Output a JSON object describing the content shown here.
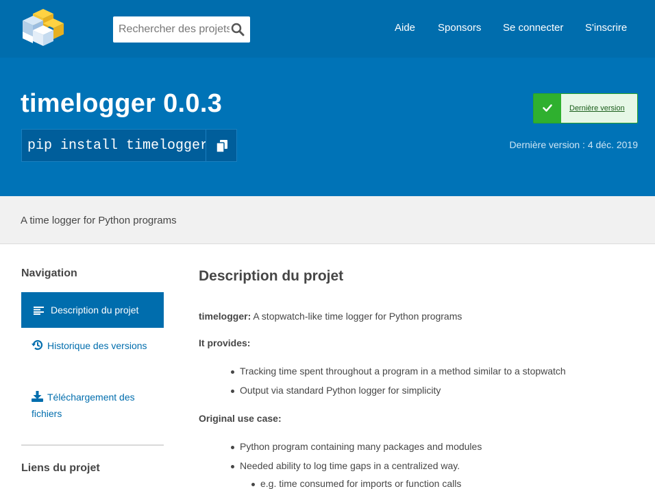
{
  "header": {
    "search_placeholder": "Rechercher des projets",
    "nav": [
      "Aide",
      "Sponsors",
      "Se connecter",
      "S'inscrire"
    ]
  },
  "banner": {
    "package_title": "timelogger 0.0.3",
    "pip_command": "pip install timelogger",
    "latest_badge": "Dernière version",
    "release_date": "Dernière version : 4 déc. 2019"
  },
  "summary": "A time logger for Python programs",
  "sidebar": {
    "navigation_heading": "Navigation",
    "items": [
      {
        "label": "Description du projet",
        "icon": "align-left-icon",
        "active": true
      },
      {
        "label": "Historique des versions",
        "icon": "history-icon",
        "active": false
      },
      {
        "label": "Téléchargement des fichiers",
        "icon": "download-icon",
        "active": false
      }
    ],
    "links_heading": "Liens du projet"
  },
  "main": {
    "title": "Description du projet",
    "intro_bold": "timelogger:",
    "intro_rest": " A stopwatch-like time logger for Python programs",
    "provides_heading": "It provides:",
    "provides": [
      "Tracking time spent throughout a program in a method similar to a stopwatch",
      "Output via standard Python logger for simplicity"
    ],
    "use_case_heading": "Original use case:",
    "use_cases": [
      "Python program containing many packages and modules",
      "Needed ability to log time gaps in a centralized way."
    ],
    "sub_use_case": "e.g. time consumed for imports or function calls"
  },
  "colors": {
    "header_blue": "#006dad",
    "banner_blue": "#0073b7",
    "badge_green": "#2fb02f"
  }
}
